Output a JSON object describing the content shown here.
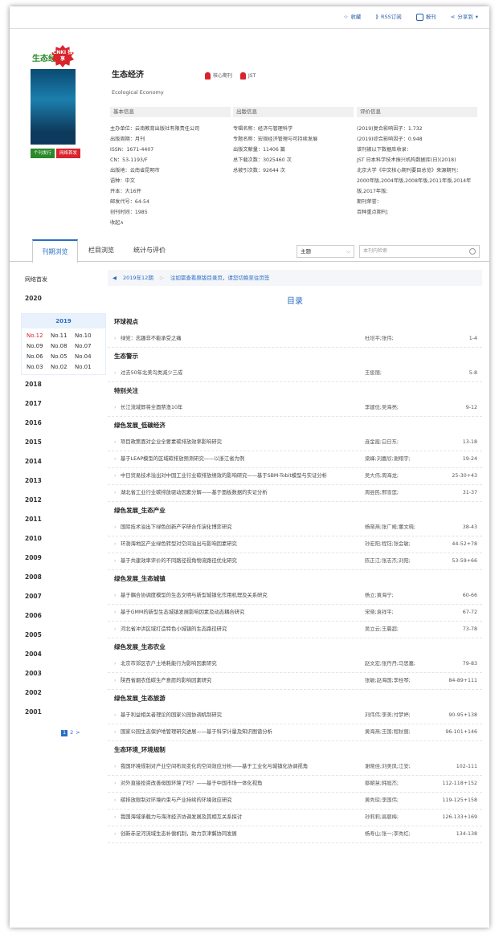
{
  "topbar": {
    "fav": "收藏",
    "rss": "RSS订阅",
    "report": "报刊",
    "share": "分享到"
  },
  "journal": {
    "cover_logo": "生态经济",
    "cnki_badge": "CNKI 独享",
    "badge1": "个刊发行",
    "badge2": "网络首发",
    "title": "生态经济",
    "title_en": "Ecological Economy",
    "tag1": "核心期刊",
    "tag2": "JST"
  },
  "basic": {
    "header": "基本信息",
    "lines": [
      "主办单位：云南教育出版社有限责任公司",
      "出版周期：月刊",
      "ISSN：1671-4407",
      "CN：53-1193/F",
      "出版地：云南省昆明市",
      "语种：中文",
      "开本：大16开",
      "邮发代号：64-54",
      "创刊时间：1985"
    ],
    "more": "收起∧"
  },
  "pub": {
    "header": "出版信息",
    "lines": [
      "专辑名称：经济与管理科学",
      "专题名称：宏观经济管理与可持续发展",
      "出版文献量：11406 篇",
      "总下载次数：3025460 次",
      "总被引次数：92644 次"
    ]
  },
  "eval": {
    "header": "评价信息",
    "lines": [
      "(2019)复合影响因子：1.732",
      "(2019)综合影响因子：0.948",
      "该刊被以下数据库收录：",
      "JST 日本科学技术振兴机构数据库(日)(2018)",
      "北京大学《中文核心期刊要目总览》来源期刊：",
      "2000年版,2004年版,2008年版,2011年版,2014年版,2017年版;",
      "期刊荣誉：",
      "百种重点期刊;"
    ]
  },
  "tabs": [
    "刊期浏览",
    "栏目浏览",
    "统计与评价"
  ],
  "search": {
    "select": "主题",
    "placeholder": "本刊内检索"
  },
  "sidebar": {
    "first": "网络首发",
    "years_top": [
      "2020"
    ],
    "expanded_year": "2019",
    "issues": [
      "No.12",
      "No.11",
      "No.10",
      "No.09",
      "No.08",
      "No.07",
      "No.06",
      "No.05",
      "No.04",
      "No.03",
      "No.02",
      "No.01"
    ],
    "years": [
      "2018",
      "2017",
      "2016",
      "2015",
      "2014",
      "2013",
      "2012",
      "2011",
      "2010",
      "2009",
      "2008",
      "2007",
      "2006",
      "2005",
      "2004",
      "2003",
      "2002",
      "2001"
    ],
    "pages": [
      "1",
      "2"
    ],
    "next": ">"
  },
  "main": {
    "issue": "2019年12期",
    "note": "注如需查看原版目录页，请您切换至往页签",
    "toc_title": "目录",
    "sections": [
      {
        "name": "环球视点",
        "rows": [
          {
            "t": "绿党：志趣非不能承受之痛",
            "a": "杜培平;张伟;",
            "p": "1-4"
          }
        ]
      },
      {
        "name": "生态警示",
        "rows": [
          {
            "t": "过去50年北美鸟类减少三成",
            "a": "王俊丽;",
            "p": "5-8"
          }
        ]
      },
      {
        "name": "特别关注",
        "rows": [
          {
            "t": "长江流域即将全面禁渔10年",
            "a": "李建伍;吴海亮;",
            "p": "9-12"
          }
        ]
      },
      {
        "name": "绿色发展_低碳经济",
        "rows": [
          {
            "t": "项目政策面对企业全要素碳排放效率影响研究",
            "a": "连金霞;白日东;",
            "p": "13-18"
          },
          {
            "t": "基于LEAP模型的区域碳排放预测研究——以浙江省为例",
            "a": "梁峰;刘嘉欣;谢翔宇;",
            "p": "19-24"
          },
          {
            "t": "中日贸易技术溢出对中国工业行业碳排放绩效的影响研究——基于SBM-Tobit模型与实证分析",
            "a": "吴大伟;周海龙;",
            "p": "25-30+43"
          },
          {
            "t": "湖北省工业行业碳排放驱动因素分解——基于面板数据的实证分析",
            "a": "周县民;邢雪莲;",
            "p": "31-37"
          }
        ]
      },
      {
        "name": "绿色发展_生态产业",
        "rows": [
          {
            "t": "国际技术溢出下绿色创新产学研合作演化博弈研究",
            "a": "杨晓燕;张广殿;董文晓;",
            "p": "38-43"
          },
          {
            "t": "环渤海地区产业绿色转型对空间溢出与影响因素研究",
            "a": "孙宏阳;程钰;张会敏;",
            "p": "44-52+78"
          },
          {
            "t": "基于共建效率评价的不同路径视角物流路径优化研究",
            "a": "陈正江;张志杰;刘阳;",
            "p": "53-59+66"
          }
        ]
      },
      {
        "name": "绿色发展_生态城镇",
        "rows": [
          {
            "t": "基于耦合协调度模型的生态文明与新型城镇化作用机理及关系研究",
            "a": "杨立;黄海宁;",
            "p": "60-66"
          },
          {
            "t": "基于GMM的新型生态城镇发展影响因素及动态耦合研究",
            "a": "宋晓;袁祥平;",
            "p": "67-72"
          },
          {
            "t": "河北省冲洪区域打造特色小城镇的生态路径研究",
            "a": "吴立云;王晨超;",
            "p": "73-78"
          }
        ]
      },
      {
        "name": "绿色发展_生态农业",
        "rows": [
          {
            "t": "北京市郊区农户土地耗能行为影响因素研究",
            "a": "赵文宏;张丹丹;马思嘉;",
            "p": "79-83"
          },
          {
            "t": "陕西省烟农低碳生产意愿的影响因素研究",
            "a": "张敏;赵海国;李桂琴;",
            "p": "84-89+111"
          }
        ]
      },
      {
        "name": "绿色发展_生态旅游",
        "rows": [
          {
            "t": "基于利益相关者理论的国家公园协调机制研究",
            "a": "刘伟伟;李美;付梦婷;",
            "p": "90-95+138"
          },
          {
            "t": "国家公园生态保护地管理研究进展——基于科学计量及知识图谱分析",
            "a": "黄海燕;王国;程秋丽;",
            "p": "96-101+146"
          }
        ]
      },
      {
        "name": "生态环境_环境规制",
        "rows": [
          {
            "t": "我国环境规制对产业空间布局变化的空间效应分析——基于工业化与城镇化协调视角",
            "a": "谢晓佳;刘美凤;江安;",
            "p": "102-111"
          },
          {
            "t": "对外直接投资改善母国环境了吗？——基于中国市场一体化视角",
            "a": "蔡朝慧;韩旭杰;",
            "p": "112-118+152"
          },
          {
            "t": "碳排放限制对环境约束与产业持续的环境效应研究",
            "a": "黄秀琼;李国伟;",
            "p": "119-125+158"
          },
          {
            "t": "我国海域承载力与海洋经济协调发展及其相互关系探讨",
            "a": "孙莉莉;高丽梅;",
            "p": "126-133+169"
          },
          {
            "t": "创新赤足河流域生态补偿机制，助力京津冀协同发展",
            "a": "杨寿山;张一;李秀红;",
            "p": "134-138"
          }
        ]
      }
    ]
  }
}
